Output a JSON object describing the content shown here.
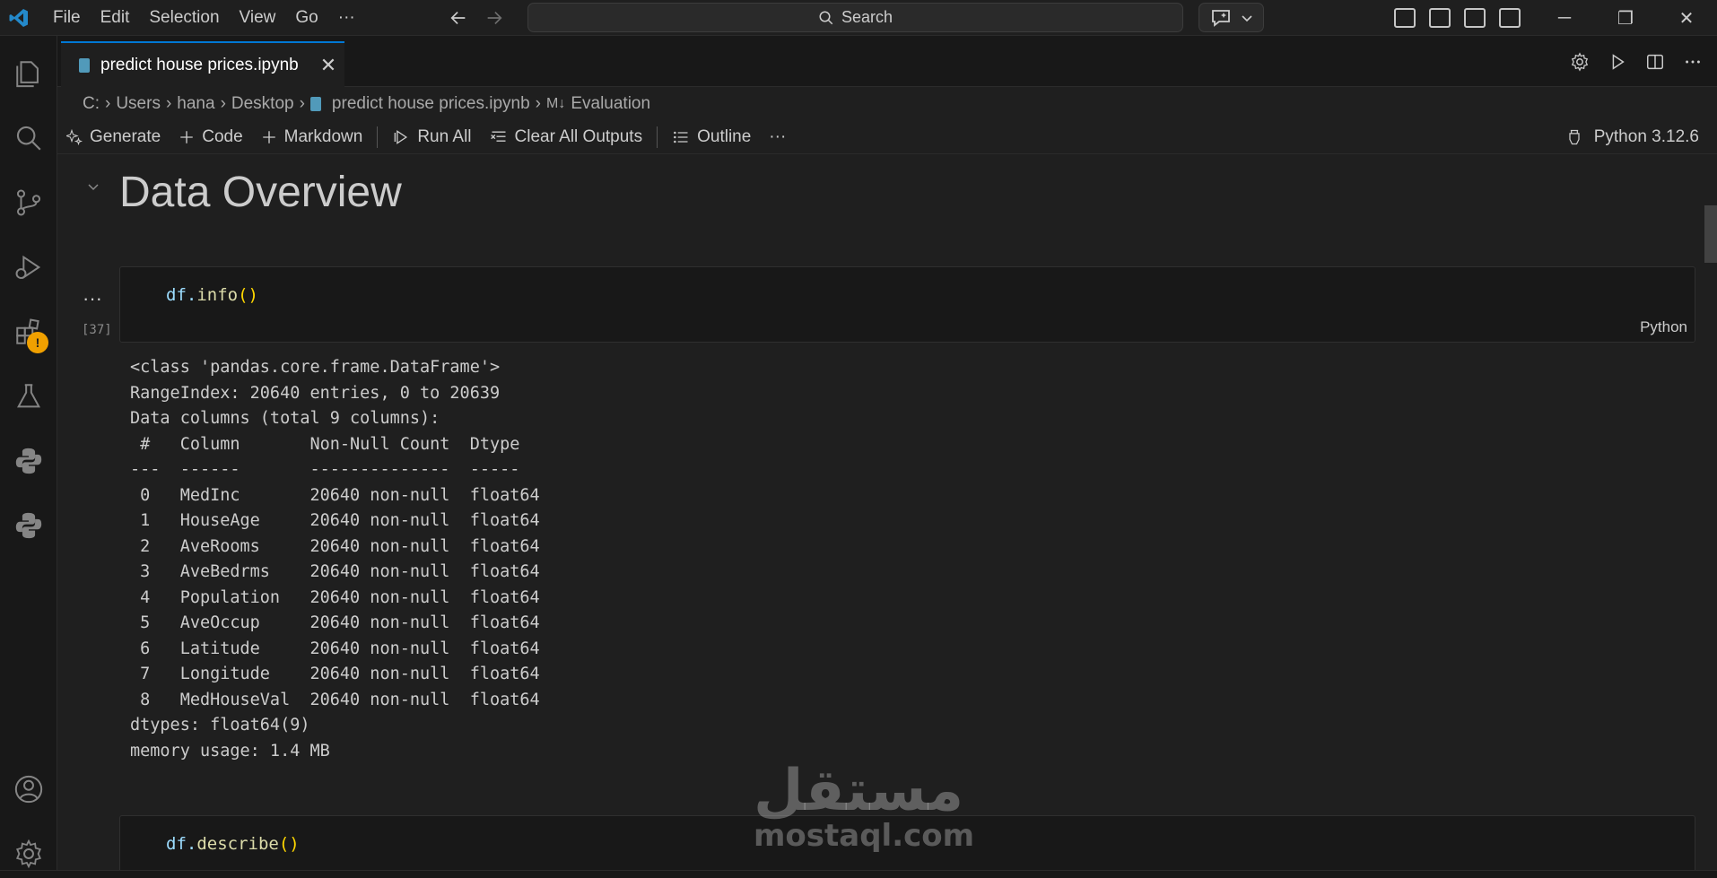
{
  "menu": [
    "File",
    "Edit",
    "Selection",
    "View",
    "Go",
    "···"
  ],
  "search": {
    "label": "Search"
  },
  "window_controls": {
    "minimize": "─",
    "restore": "❐",
    "close": "✕"
  },
  "tab": {
    "title": "predict house prices.ipynb",
    "close": "✕"
  },
  "breadcrumb": [
    "C:",
    "Users",
    "hana",
    "Desktop",
    "predict house prices.ipynb",
    "Evaluation"
  ],
  "toolbar": {
    "generate": "Generate",
    "code": "Code",
    "markdown": "Markdown",
    "run_all": "Run All",
    "clear_outputs": "Clear All Outputs",
    "outline": "Outline",
    "more": "···",
    "kernel": "Python 3.12.6"
  },
  "notebook": {
    "heading": "Data Overview",
    "cell1": {
      "var": "df.",
      "fn": "info",
      "paren": "()",
      "exec_count": "[37]",
      "lang": "Python"
    },
    "output_dots": "···",
    "output_lines": [
      "<class 'pandas.core.frame.DataFrame'>",
      "RangeIndex: 20640 entries, 0 to 20639",
      "Data columns (total 9 columns):",
      " #   Column       Non-Null Count  Dtype  ",
      "---  ------       --------------  -----  ",
      " 0   MedInc       20640 non-null  float64",
      " 1   HouseAge     20640 non-null  float64",
      " 2   AveRooms     20640 non-null  float64",
      " 3   AveBedrms    20640 non-null  float64",
      " 4   Population   20640 non-null  float64",
      " 5   AveOccup     20640 non-null  float64",
      " 6   Latitude     20640 non-null  float64",
      " 7   Longitude    20640 non-null  float64",
      " 8   MedHouseVal  20640 non-null  float64",
      "dtypes: float64(9)",
      "memory usage: 1.4 MB"
    ],
    "cell2": {
      "var": "df.",
      "fn": "describe",
      "paren": "()"
    }
  },
  "watermark": {
    "arabic": "مستقل",
    "latin": "mostaql.com"
  },
  "colors": {
    "accent": "#0078d4",
    "warning": "#f0a000",
    "file_icon": "#519aba"
  }
}
